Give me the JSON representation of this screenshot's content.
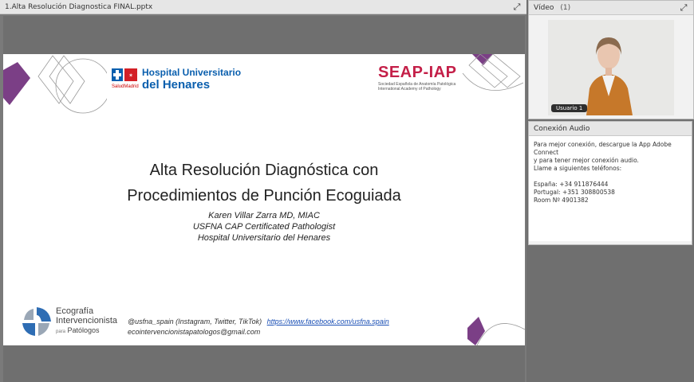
{
  "share_pod": {
    "title": "1.Alta Resolución Diagnostica FINAL.pptx"
  },
  "slide": {
    "title_line1": "Alta Resolución Diagnóstica con",
    "title_line2": "Procedimientos de Punción Ecoguiada",
    "author": "Karen Villar Zarra MD, MIAC",
    "cert": "USFNA CAP Certificated Pathologist",
    "hospital": "Hospital Universitario del Henares",
    "social": "@usfna_spain (Instagram, Twitter, TikTok)",
    "facebook": "https://www.facebook.com/usfna.spain",
    "email": "ecointervencionistapatologos@gmail.com",
    "hosp_logo_l1": "Hospital Universitario",
    "hosp_logo_l2": "del Henares",
    "salud_label": "SaludMadrid",
    "seap_name": "SEAP-IAP",
    "seap_sub1": "Sociedad Española de Anatomía Patológica",
    "seap_sub2": "International Academy of Pathology",
    "eco_l1": "Ecografía",
    "eco_l2": "Intervencionista",
    "eco_l3_small": "para",
    "eco_l3": "Patólogos"
  },
  "video_pod": {
    "title": "Vídeo",
    "count": "(1)",
    "user_label": "Usuario 1"
  },
  "audio_pod": {
    "title": "Conexión Audio",
    "line1": "Para mejor conexión, descargue la App Adobe Connect",
    "line2": "y para tener mejor conexión audio.",
    "line3": "Llame a siguientes teléfonos:",
    "spain": "España: +34 911876444",
    "portugal": "Portugal: +351 308800538",
    "room": "Room Nº 4901382"
  },
  "colors": {
    "purple": "#7b3f86",
    "hospital_blue": "#0a5fae",
    "seap_red": "#c41f48",
    "link_blue": "#1a4fb5",
    "sweater": "#c6782a"
  }
}
